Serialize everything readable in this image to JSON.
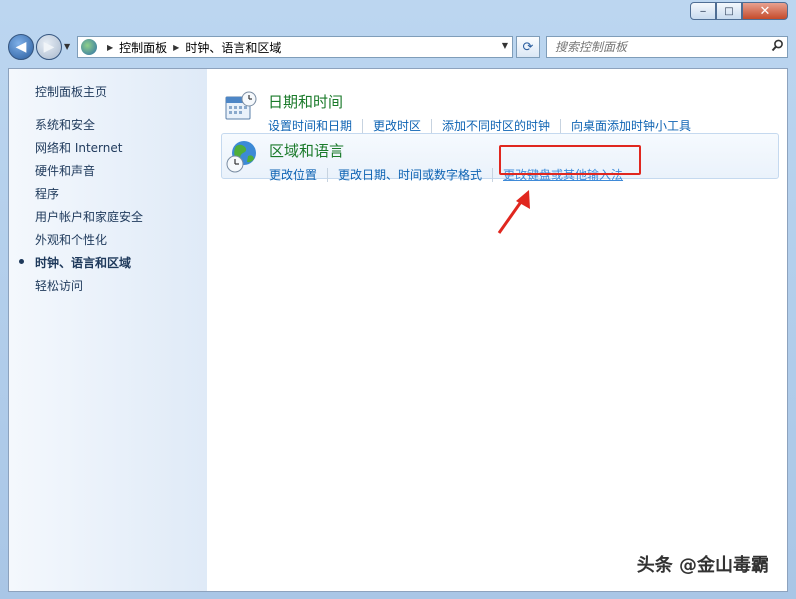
{
  "window": {
    "caption": {
      "minimize": "‒",
      "maximize": "□",
      "close": "✕"
    }
  },
  "nav": {
    "back_label": "◀",
    "forward_label": "▶",
    "breadcrumb": [
      "控制面板",
      "时钟、语言和区域"
    ],
    "refresh_glyph": "⟳",
    "search": {
      "placeholder": "搜索控制面板"
    }
  },
  "sidebar": {
    "home": "控制面板主页",
    "items": [
      {
        "label": "系统和安全"
      },
      {
        "label": "网络和 Internet"
      },
      {
        "label": "硬件和声音"
      },
      {
        "label": "程序"
      },
      {
        "label": "用户帐户和家庭安全"
      },
      {
        "label": "外观和个性化"
      },
      {
        "label": "时钟、语言和区域",
        "current": true
      },
      {
        "label": "轻松访问"
      }
    ]
  },
  "categories": [
    {
      "title": "日期和时间",
      "icon": "calendar-clock-icon",
      "links": [
        "设置时间和日期",
        "更改时区",
        "添加不同时区的时钟",
        "向桌面添加时钟小工具"
      ]
    },
    {
      "title": "区域和语言",
      "icon": "globe-clock-icon",
      "links": [
        "更改位置",
        "更改日期、时间或数字格式",
        "更改键盘或其他输入法"
      ]
    }
  ],
  "annotation": {
    "color": "#e0271f"
  },
  "watermark": "头条 @金山毒霸"
}
